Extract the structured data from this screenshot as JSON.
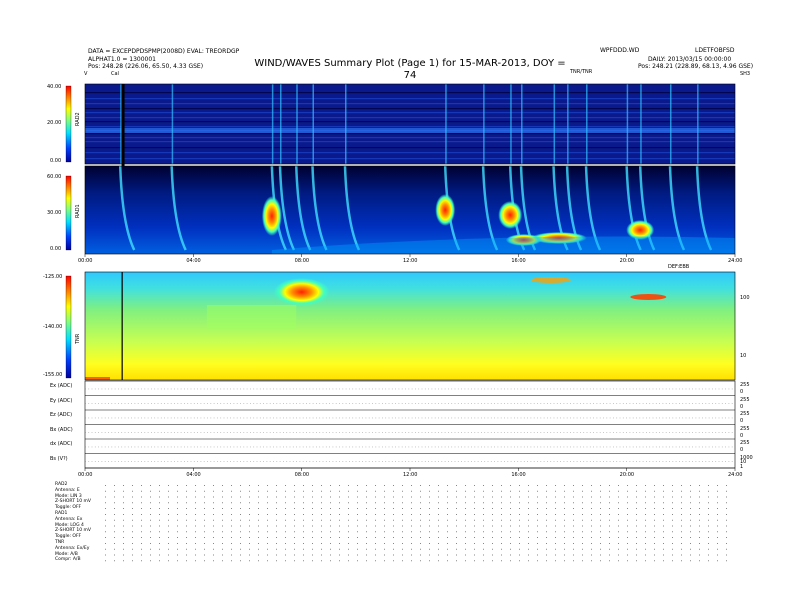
{
  "header": {
    "title": "WIND/WAVES Summary Plot (Page 1) for 15-MAR-2013, DOY = 74",
    "left_line1": "DATA = EXCEPDPDSPMP(2008D) EVAL: TREORDGP",
    "left_line2": "ALPHAT1.0 = 1300001",
    "left_pos": "Pos:    248.28 (226.06, 65.50, 4.33 GSE)",
    "right_top1": "WPFDDD.WD",
    "right_top2": "LDETFOBFSD",
    "right_line2": "DAILY: 2013/03/15 00:00:00",
    "right_pos": "Pos:    248.21 (228.89, 68.13, 4.96 GSE)",
    "tnr_label": "TNR/TNR",
    "small_v_left": "V",
    "small_cal": "Cal",
    "small_right": "SH3"
  },
  "colors": {
    "background": "#ffffff",
    "spectrogram_base": "#0a1a8c",
    "bar_gradient": [
      "#0000a0",
      "#0040ff",
      "#00e0ff",
      "#80ff80",
      "#ffff00",
      "#ff8000",
      "#ff0000"
    ]
  },
  "chart_data": [
    {
      "type": "heatmap",
      "name": "RAD2",
      "ylabel": "RAD2",
      "colorbar_ticks": [
        "40.00",
        "20.00",
        "0.00"
      ],
      "clim": [
        0,
        40
      ]
    },
    {
      "type": "heatmap",
      "name": "RAD1",
      "ylabel": "RAD1",
      "colorbar_ticks": [
        "60.00",
        "30.00",
        "0.00"
      ],
      "clim": [
        0,
        60
      ],
      "x_ticks": [
        "00:00",
        "04:00",
        "08:00",
        "12:00",
        "16:00",
        "20:00",
        "24:00"
      ],
      "x_extra_label": "DEF:EBB",
      "type_iii_bursts_hours": [
        1.3,
        3.2,
        6.9,
        7.2,
        7.8,
        8.4,
        9.6,
        13.3,
        14.7,
        15.7,
        16.1,
        17.3,
        17.8,
        18.5,
        20.0,
        20.5,
        21.6,
        22.6
      ]
    },
    {
      "type": "heatmap",
      "name": "TNR",
      "ylabel": "TNR",
      "colorbar_ticks": [
        "-125.00",
        "-140.00",
        "-155.00"
      ],
      "clim": [
        -155,
        -125
      ],
      "right_axis_ticks": [
        "100",
        "10"
      ],
      "x_ticks": [
        "00:00",
        "04:00",
        "08:00",
        "12:00",
        "16:00",
        "20:00",
        "24:00"
      ]
    },
    {
      "type": "line",
      "name": "housekeeping",
      "rows": [
        {
          "label": "Ex (ADC)",
          "ticks": [
            "255",
            "0"
          ]
        },
        {
          "label": "Ey (ADC)",
          "ticks": [
            "255",
            "0"
          ]
        },
        {
          "label": "Ez (ADC)",
          "ticks": [
            "255",
            "0"
          ]
        },
        {
          "label": "Bx (ADC)",
          "ticks": [
            "255",
            "0"
          ]
        },
        {
          "label": "dx (ADC)",
          "ticks": [
            "255",
            "0"
          ]
        },
        {
          "label": "Bs (V?)",
          "ticks": [
            "1000",
            "10",
            "1"
          ]
        }
      ],
      "x_ticks": [
        "00:00",
        "04:00",
        "08:00",
        "12:00",
        "16:00",
        "20:00",
        "24:00"
      ]
    }
  ],
  "footer": {
    "lines": [
      "RAD2",
      "Antenna:   E",
      "Mode:   LIN 3",
      "Z-SHORT 10 mV",
      "Toggle:    OFF",
      "RAD1",
      "Antenna:   Ex",
      "Mode:   LOG 4",
      "Z-SHORT 10 mV",
      "Toggle:    OFF",
      "TNR",
      "Antenna:  Ex/Ey",
      "Mode:    A/B",
      "Compr:    A/B"
    ]
  }
}
